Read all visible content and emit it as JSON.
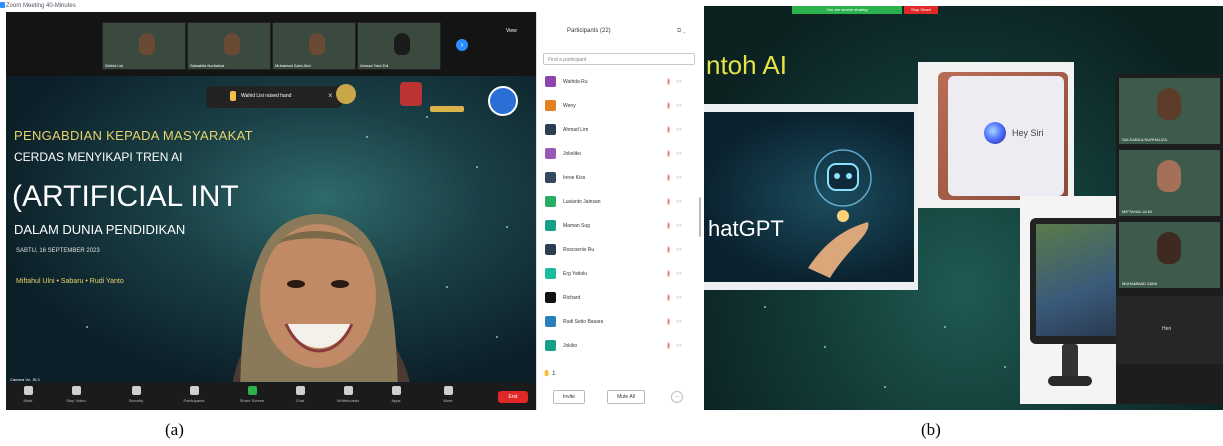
{
  "captions": {
    "a": "(a)",
    "b": "(b)"
  },
  "zoom": {
    "window_title": "Zoom Meeting 40-Minutes",
    "thumbnails": [
      "Wahid Lisi",
      "Salsabila Nurhaliza",
      "Muhamad Zaini Abd",
      "Ahmad Yani Edi"
    ],
    "next_icon": "›",
    "view_label": "View",
    "notification": {
      "text": "Wahid Lisi raised hand",
      "close": "×"
    },
    "slide": {
      "line1": "PENGABDIAN KEPADA MASYARAKAT",
      "line2": "CERDAS MENYIKAPI TREN AI",
      "line3": "(ARTIFICIAL INT",
      "line4": "DALAM DUNIA PENDIDIKAN",
      "date": "SABTU, 16 SEPTEMBER 2023",
      "presenters": "Miftahul Ulni  •  Sabaru  •  Rudi Yanto"
    },
    "video_name": "Camera Vn. St.3",
    "toolbar": [
      {
        "label": "Mute",
        "icon": "microphone-icon"
      },
      {
        "label": "Stop Video",
        "icon": "video-icon"
      },
      {
        "label": "Security",
        "icon": "shield-icon"
      },
      {
        "label": "Participants",
        "icon": "people-icon",
        "count": "22"
      },
      {
        "label": "Share Screen",
        "icon": "share-screen-icon"
      },
      {
        "label": "Chat",
        "icon": "chat-icon"
      },
      {
        "label": "Whiteboards",
        "icon": "whiteboard-icon"
      },
      {
        "label": "Apps",
        "icon": "apps-icon"
      },
      {
        "label": "More",
        "icon": "more-icon"
      }
    ],
    "end_button": "End",
    "participants": {
      "title": "Participants (22)",
      "search_placeholder": "Find a participant",
      "list": [
        {
          "name": "Wahida Ru",
          "color": "#8e44ad"
        },
        {
          "name": "Weny",
          "color": "#e67e22"
        },
        {
          "name": "Ahmad Lim",
          "color": "#2c3e50"
        },
        {
          "name": "Jokeliko",
          "color": "#9b59b6"
        },
        {
          "name": "Irene Kiss",
          "color": "#34495e"
        },
        {
          "name": "Lusianto Jainsan",
          "color": "#27ae60"
        },
        {
          "name": "Maman Sug",
          "color": "#16a085"
        },
        {
          "name": "Roscoenis Ru",
          "color": "#2c3e50"
        },
        {
          "name": "Erg Yatiolu",
          "color": "#1abc9c"
        },
        {
          "name": "Richard",
          "color": "#111111"
        },
        {
          "name": "Rudi Setio Basara",
          "color": "#2980b9"
        },
        {
          "name": "Jokiko",
          "color": "#16a085"
        }
      ],
      "raised_hands": "1",
      "invite_label": "Invite",
      "mute_all_label": "Mute All",
      "more_label": "···"
    }
  },
  "ai_slide": {
    "share_bar": {
      "status": "You are screen sharing",
      "stop": "Stop Share"
    },
    "title": "ntoh AI",
    "chatgpt_label": "hatGPT",
    "siri_label": "Hey Siri",
    "gallery": [
      "SALSABILA NURHALIZA",
      "MIFTAHUL ULNI",
      "MUHAMMAD ZAINI"
    ],
    "black_tile_name": "Heri"
  }
}
